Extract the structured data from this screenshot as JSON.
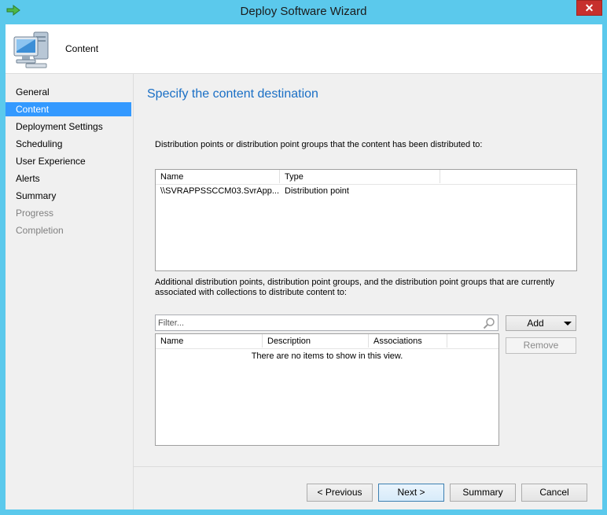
{
  "window": {
    "title": "Deploy Software Wizard",
    "close_glyph": "✕"
  },
  "header": {
    "title": "Content",
    "icon": "computer-icon"
  },
  "nav": {
    "items": [
      {
        "label": "General",
        "state": "normal"
      },
      {
        "label": "Content",
        "state": "selected"
      },
      {
        "label": "Deployment Settings",
        "state": "normal"
      },
      {
        "label": "Scheduling",
        "state": "normal"
      },
      {
        "label": "User Experience",
        "state": "normal"
      },
      {
        "label": "Alerts",
        "state": "normal"
      },
      {
        "label": "Summary",
        "state": "normal"
      },
      {
        "label": "Progress",
        "state": "disabled"
      },
      {
        "label": "Completion",
        "state": "disabled"
      }
    ]
  },
  "main": {
    "heading": "Specify the content destination",
    "distributed_description": "Distribution points or distribution point groups that the content has been distributed to:",
    "distributed_list": {
      "columns": [
        "Name",
        "Type"
      ],
      "rows": [
        {
          "name": "\\\\SVRAPPSSCCM03.SvrApp...",
          "type": "Distribution point"
        }
      ]
    },
    "additional_description": "Additional distribution points, distribution point groups, and the distribution point groups that are currently associated with collections to distribute content to:",
    "filter": {
      "placeholder": "Filter...",
      "value": ""
    },
    "additional_list": {
      "columns": [
        "Name",
        "Description",
        "Associations"
      ],
      "empty_message": "There are no items to show in this view."
    },
    "add_button": "Add",
    "remove_button": "Remove"
  },
  "footer": {
    "previous": "< Previous",
    "next": "Next >",
    "summary": "Summary",
    "cancel": "Cancel"
  },
  "colors": {
    "accent": "#3399ff",
    "heading": "#1a6fc5",
    "frame": "#5bc9ec",
    "close": "#c7302d"
  }
}
